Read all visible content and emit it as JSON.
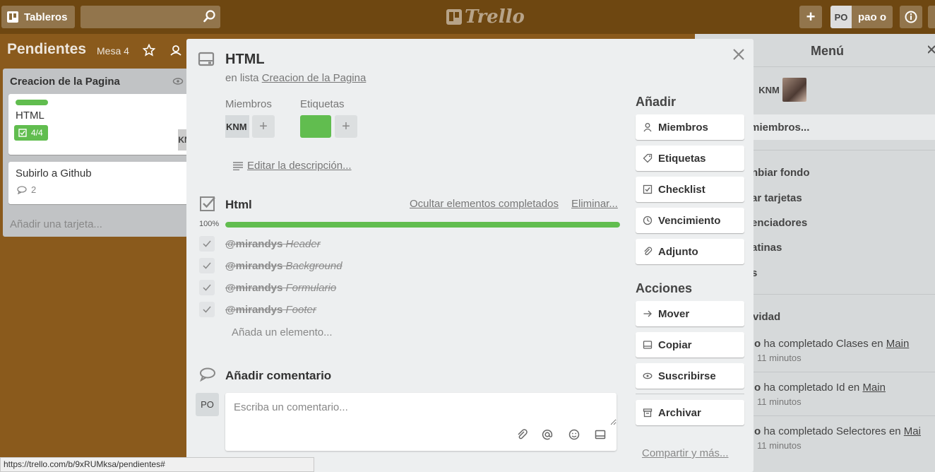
{
  "topbar": {
    "boards_label": "Tableros",
    "logo_text": "Trello",
    "add_label": "+",
    "user_initials": "PO",
    "username": "pao o"
  },
  "board": {
    "title": "Pendientes",
    "team": "Mesa 4"
  },
  "list": {
    "title": "Creacion de la Pagina",
    "cards": [
      {
        "title": "HTML",
        "badge": "4/4",
        "member": "KNM"
      },
      {
        "title": "Subirlo a Github",
        "comments": "2"
      }
    ],
    "add_card": "Añadir una tarjeta..."
  },
  "menu": {
    "title": "Menú",
    "member_initials": "KNM",
    "add_members": "ir miembros...",
    "items": [
      "nbiar fondo",
      "ar tarjetas",
      "enciadores",
      "atinas",
      "s"
    ],
    "activity_title": "vidad",
    "activity": [
      {
        "user": "o",
        "text": " ha completado Clases en ",
        "link": "Main",
        "time": "11 minutos"
      },
      {
        "user": "o",
        "text": " ha completado Id en ",
        "link": "Main",
        "time": "11 minutos"
      },
      {
        "user": "o",
        "text": " ha completado Selectores en ",
        "link": "Mai",
        "time": "11 minutos"
      }
    ]
  },
  "modal": {
    "title": "HTML",
    "in_list_prefix": "en lista ",
    "in_list_name": "Creacion de la Pagina",
    "members_label": "Miembros",
    "member_initials": "KNM",
    "labels_label": "Etiquetas",
    "label_color": "#61bd4f",
    "edit_description": "Editar la descripción...",
    "checklist": {
      "title": "Html",
      "hide_completed": "Ocultar elementos completados",
      "delete": "Eliminar...",
      "progress_text": "100%",
      "progress": 100,
      "items": [
        {
          "mention": "@mirandys",
          "text": " Header"
        },
        {
          "mention": "@mirandys",
          "text": " Background"
        },
        {
          "mention": "@mirandys",
          "text": " Formulario"
        },
        {
          "mention": "@mirandys",
          "text": " Footer"
        }
      ],
      "add_item": "Añada un elemento..."
    },
    "comment": {
      "title": "Añadir comentario",
      "avatar": "PO",
      "placeholder": "Escriba un comentario..."
    },
    "add_section": {
      "title": "Añadir",
      "buttons": [
        "Miembros",
        "Etiquetas",
        "Checklist",
        "Vencimiento",
        "Adjunto"
      ]
    },
    "actions_section": {
      "title": "Acciones",
      "buttons": [
        "Mover",
        "Copiar",
        "Suscribirse",
        "Archivar"
      ]
    },
    "share_more": "Compartir y más..."
  },
  "status_url": "https://trello.com/b/9xRUMksa/pendientes#",
  "colors": {
    "board_bg": "#8a5a1c",
    "header_bg": "#6e4711",
    "accent_green": "#61bd4f"
  }
}
